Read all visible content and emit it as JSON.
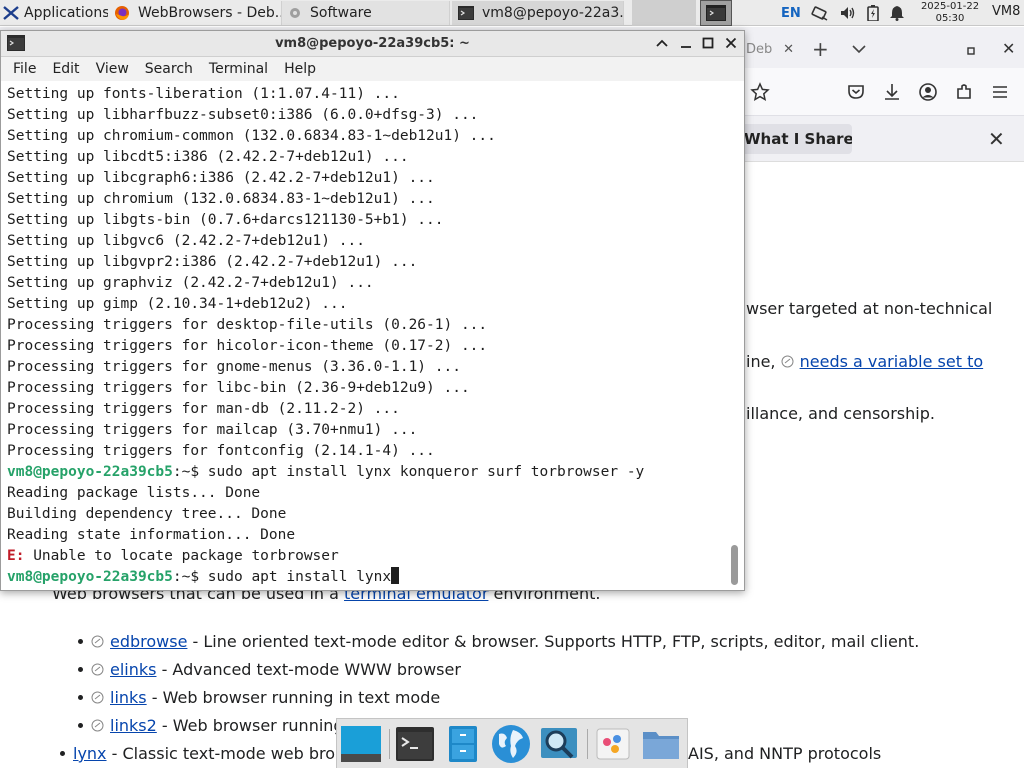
{
  "panel": {
    "apps_label": "Applications",
    "tasks": [
      {
        "label": "WebBrowsers - Deb..."
      },
      {
        "label": "Software"
      },
      {
        "label": "vm8@pepoyo-22a3..."
      }
    ],
    "lang": "EN",
    "clock_date": "2025-01-22",
    "clock_time": "05:30",
    "user_short": "VM8"
  },
  "browser": {
    "tab_label": "Deb",
    "notice_button": "What I Share",
    "lines": {
      "intro1": "wser targeted at non-technical",
      "intro2_pre": "ine, ",
      "intro2_link": "needs a variable set to",
      "intro3": "illance, and censorship.",
      "term_pre": "Web browsers that can be used in a ",
      "term_link": "terminal emulator",
      "term_post": " environment."
    },
    "items": [
      {
        "name": "edbrowse",
        "desc": " - Line oriented text-mode editor & browser. Supports HTTP, FTP, scripts, editor, mail client."
      },
      {
        "name": "elinks",
        "desc": " - Advanced text-mode WWW browser"
      },
      {
        "name": "links",
        "desc": " - Web browser running in text mode"
      },
      {
        "name": "links2",
        "desc": " - Web browser running"
      },
      {
        "name": "lynx",
        "desc_pre": " - Classic text-mode web bro",
        "desc_post": "AIS, and NNTP protocols"
      }
    ]
  },
  "terminal": {
    "title": "vm8@pepoyo-22a39cb5: ~",
    "menu": [
      "File",
      "Edit",
      "View",
      "Search",
      "Terminal",
      "Help"
    ],
    "prompt_user": "vm8@pepoyo-22a39cb5",
    "prompt_sep": ":~$ ",
    "lines": [
      "Setting up fonts-liberation (1:1.07.4-11) ...",
      "Setting up libharfbuzz-subset0:i386 (6.0.0+dfsg-3) ...",
      "Setting up chromium-common (132.0.6834.83-1~deb12u1) ...",
      "Setting up libcdt5:i386 (2.42.2-7+deb12u1) ...",
      "Setting up libcgraph6:i386 (2.42.2-7+deb12u1) ...",
      "Setting up chromium (132.0.6834.83-1~deb12u1) ...",
      "Setting up libgts-bin (0.7.6+darcs121130-5+b1) ...",
      "Setting up libgvc6 (2.42.2-7+deb12u1) ...",
      "Setting up libgvpr2:i386 (2.42.2-7+deb12u1) ...",
      "Setting up graphviz (2.42.2-7+deb12u1) ...",
      "Setting up gimp (2.10.34-1+deb12u2) ...",
      "Processing triggers for desktop-file-utils (0.26-1) ...",
      "Processing triggers for hicolor-icon-theme (0.17-2) ...",
      "Processing triggers for gnome-menus (3.36.0-1.1) ...",
      "Processing triggers for libc-bin (2.36-9+deb12u9) ...",
      "Processing triggers for man-db (2.11.2-2) ...",
      "Processing triggers for mailcap (3.70+nmu1) ...",
      "Processing triggers for fontconfig (2.14.1-4) ..."
    ],
    "command1": "sudo apt install lynx konqueror surf torbrowser -y",
    "output": [
      "Reading package lists... Done",
      "Building dependency tree... Done",
      "Reading state information... Done"
    ],
    "error_label": "E:",
    "error_text": " Unable to locate package torbrowser",
    "command2": "sudo apt install lynx"
  },
  "colors": {
    "prompt_green": "#26a269",
    "error_red": "#c01c28",
    "link_blue": "#0645ad"
  },
  "dock": {
    "items": [
      "screen-icon",
      "terminal-icon",
      "file-cabinet-icon",
      "browser-globe-icon",
      "search-magnifier-icon",
      "image-viewer-icon",
      "folder-icon"
    ]
  }
}
